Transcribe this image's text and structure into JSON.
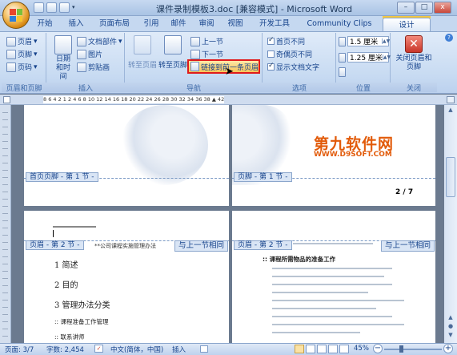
{
  "window": {
    "title": "课件录制模板3.doc [兼容模式] - Microsoft Word",
    "minimize": "–",
    "maximize": "□",
    "close": "x"
  },
  "tabs": [
    {
      "label": "开始"
    },
    {
      "label": "插入"
    },
    {
      "label": "页面布局"
    },
    {
      "label": "引用"
    },
    {
      "label": "邮件"
    },
    {
      "label": "审阅"
    },
    {
      "label": "视图"
    },
    {
      "label": "开发工具"
    },
    {
      "label": "Community Clips"
    },
    {
      "label": "设计"
    }
  ],
  "ribbon": {
    "header_footer": {
      "label": "页眉和页脚",
      "header": "页眉",
      "footer": "页脚",
      "page_number": "页码"
    },
    "insert": {
      "label": "插入",
      "datetime": "日期和时间",
      "parts": "文档部件",
      "picture": "图片",
      "clipart": "剪贴画"
    },
    "navigation": {
      "label": "导航",
      "goto_header": "转至页眉",
      "goto_footer": "转至页脚",
      "prev": "上一节",
      "next": "下一节",
      "link_prev": "链接到前一条页眉"
    },
    "options": {
      "label": "选项",
      "diff_first": "首页不同",
      "diff_odd_even": "奇偶页不同",
      "show_text": "显示文档文字",
      "checked": {
        "diff_first": true,
        "diff_odd_even": false,
        "show_text": true
      }
    },
    "position": {
      "label": "位置",
      "header_dist": "1.5 厘米",
      "footer_dist": "1.25 厘米"
    },
    "close": {
      "label": "关闭",
      "close_button": "关闭页眉和页脚"
    }
  },
  "ruler": {
    "numbers": "8 6 4 2 1 2 4 6 8 10 12 14 16 18 20 22 24 26 28 30 32 34 36 38 ▲ 42 44 46 48"
  },
  "document": {
    "footer_label_1": "首页页脚 - 第 1 节 -",
    "footer_label_2": "页脚 - 第 1 节 -",
    "page_number": "2 / 7",
    "header_label_left": "页眉 - 第 2 节 -",
    "header_label_right": "页眉 - 第 2 节 -",
    "same_as_prev_left": "与上一节相同",
    "same_as_prev_right": "与上一节相同",
    "header_text": "**公司课程实施管理办法",
    "outline": [
      "1 简述",
      "2 目的",
      "3 管理办法分类"
    ],
    "subitems": [
      "课程准备工作管理",
      "联系讲师"
    ],
    "right_heading": "课程所需物品的准备工作",
    "watermark_cn": "第九软件网",
    "watermark_url": "WWW.D9SOFT.COM"
  },
  "status": {
    "page": "页面: 3/7",
    "words": "字数: 2,454",
    "language": "中文(简体，中国)",
    "mode": "插入",
    "zoom": "45%",
    "zoom_minus": "−",
    "zoom_plus": "+"
  }
}
